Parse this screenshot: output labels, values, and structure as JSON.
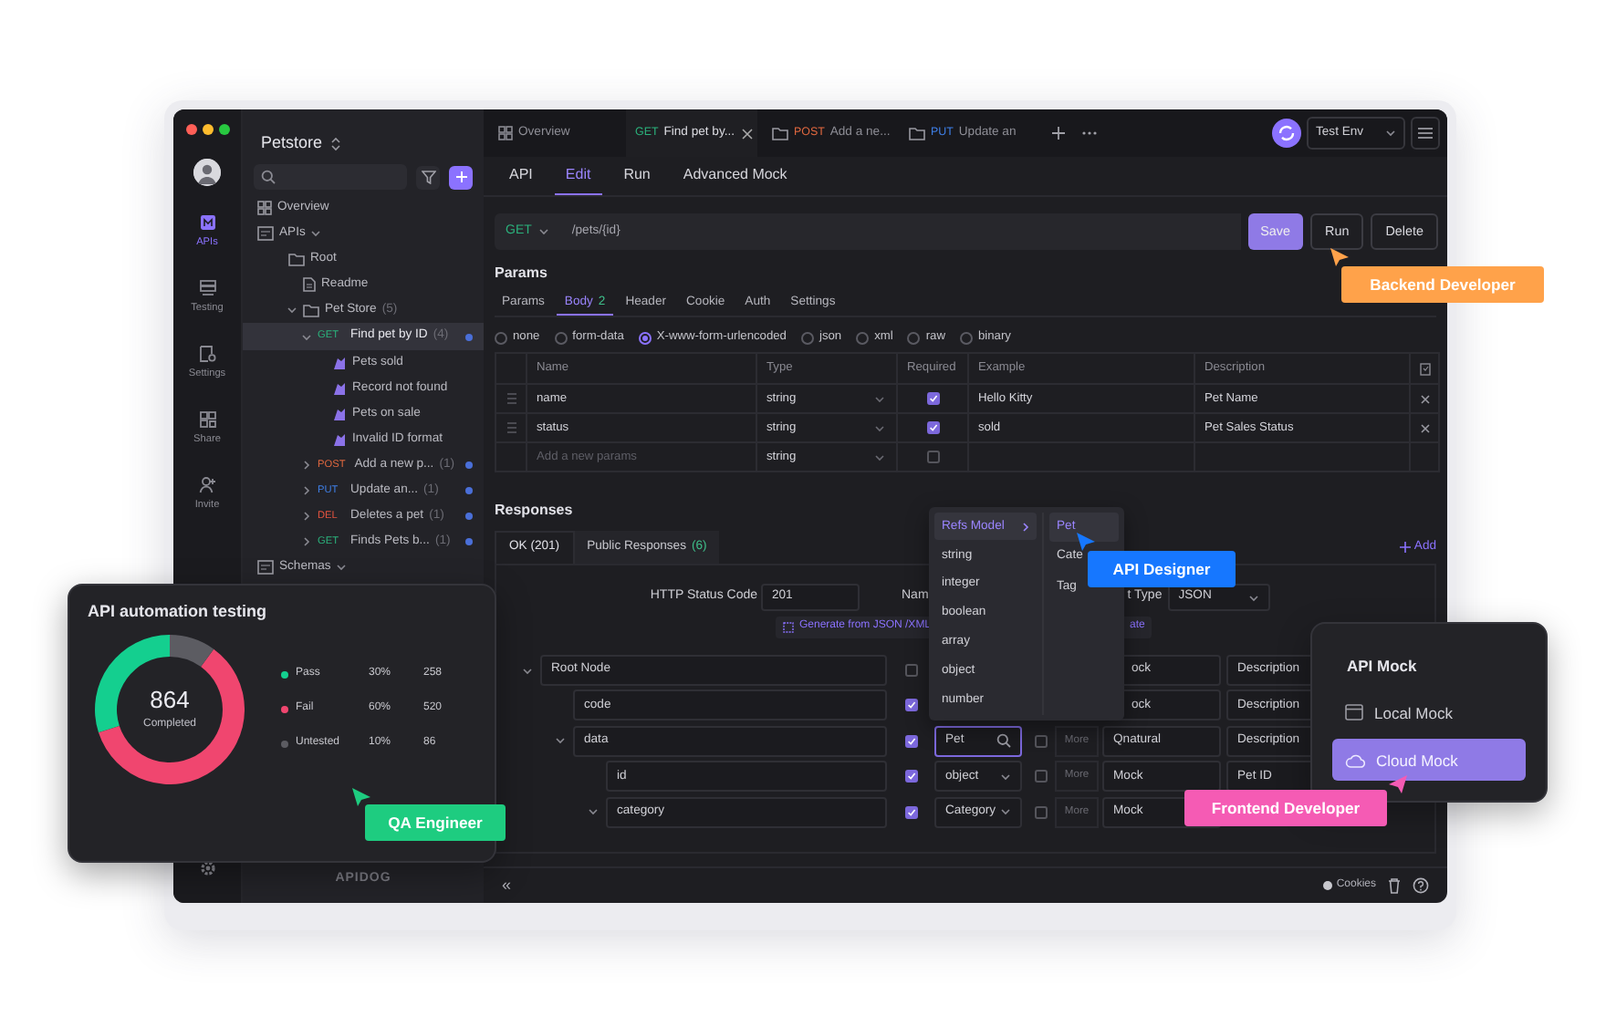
{
  "rail": {
    "items": [
      {
        "kind": "apis",
        "label": "APIs",
        "selected": true
      },
      {
        "kind": "testing",
        "label": "Testing",
        "selected": false
      },
      {
        "kind": "settings",
        "label": "Settings",
        "selected": false
      },
      {
        "kind": "share",
        "label": "Share",
        "selected": false
      },
      {
        "kind": "invite",
        "label": "Invite",
        "selected": false
      }
    ]
  },
  "sidebar": {
    "project": "Petstore",
    "logo": "APIDOG",
    "tree": [
      {
        "kind": "overview",
        "label": "Overview",
        "selected": false
      },
      {
        "kind": "group",
        "label": "APIs",
        "expanded": true,
        "selected": false,
        "children": [
          {
            "kind": "folder",
            "label": "Root",
            "selected": false,
            "children": [
              {
                "kind": "doc",
                "label": "Readme",
                "selected": false
              },
              {
                "kind": "folder",
                "label": "Pet Store",
                "count": "(5)",
                "expanded": true,
                "selected": false,
                "children": [
                  {
                    "kind": "api",
                    "method": "GET",
                    "color": "#2bb27c",
                    "label": "Find pet by ID",
                    "count": "(4)",
                    "expanded": true,
                    "selected": true,
                    "children": [
                      {
                        "kind": "case",
                        "label": "Pets sold",
                        "selected": false
                      },
                      {
                        "kind": "case",
                        "label": "Record not found",
                        "selected": false
                      },
                      {
                        "kind": "case",
                        "label": "Pets on sale",
                        "selected": false
                      },
                      {
                        "kind": "case",
                        "label": "Invalid ID format",
                        "selected": false
                      }
                    ]
                  },
                  {
                    "kind": "api",
                    "method": "POST",
                    "color": "#e0683f",
                    "label": "Add a new p...",
                    "count": "(1)",
                    "expanded": false,
                    "selected": false
                  },
                  {
                    "kind": "api",
                    "method": "PUT",
                    "color": "#3f7fe6",
                    "label": "Update an...",
                    "count": "(1)",
                    "expanded": false,
                    "selected": false
                  },
                  {
                    "kind": "api",
                    "method": "DEL",
                    "color": "#e2533f",
                    "label": "Deletes a pet",
                    "count": "(1)",
                    "expanded": false,
                    "selected": false
                  },
                  {
                    "kind": "api",
                    "method": "GET",
                    "color": "#2bb27c",
                    "label": "Finds Pets b...",
                    "count": "(1)",
                    "expanded": false,
                    "selected": false
                  }
                ]
              }
            ]
          }
        ]
      },
      {
        "kind": "group",
        "label": "Schemas",
        "expanded": true,
        "selected": false
      }
    ]
  },
  "tabs": [
    {
      "kind": "overview",
      "label": "Overview",
      "selected": false
    },
    {
      "kind": "api",
      "method": "GET",
      "color": "#2bb27c",
      "label": "Find pet by...",
      "selected": true
    },
    {
      "kind": "folder",
      "method": "POST",
      "color": "#e0683f",
      "label": "Add a ne...",
      "selected": false
    },
    {
      "kind": "folder",
      "method": "PUT",
      "color": "#3f7fe6",
      "label": "Update an",
      "selected": false
    }
  ],
  "environment": "Test Env",
  "editor_tabs": [
    {
      "label": "API",
      "selected": false
    },
    {
      "label": "Edit",
      "selected": true
    },
    {
      "label": "Run",
      "selected": false
    },
    {
      "label": "Advanced Mock",
      "selected": false
    }
  ],
  "request": {
    "method": "GET",
    "path": "/pets/{id}",
    "buttons": [
      {
        "label": "Save",
        "kind": "primary"
      },
      {
        "label": "Run",
        "kind": "outline"
      },
      {
        "label": "Delete",
        "kind": "outline"
      }
    ]
  },
  "params": {
    "title": "Params",
    "tabs": [
      {
        "label": "Params",
        "selected": false
      },
      {
        "label": "Body",
        "count": "2",
        "selected": true
      },
      {
        "label": "Header",
        "selected": false
      },
      {
        "label": "Cookie",
        "selected": false
      },
      {
        "label": "Auth",
        "selected": false
      },
      {
        "label": "Settings",
        "selected": false
      }
    ],
    "body_types": [
      {
        "label": "none",
        "selected": false
      },
      {
        "label": "form-data",
        "selected": false
      },
      {
        "label": "X-www-form-urlencoded",
        "selected": true
      },
      {
        "label": "json",
        "selected": false
      },
      {
        "label": "xml",
        "selected": false
      },
      {
        "label": "raw",
        "selected": false
      },
      {
        "label": "binary",
        "selected": false
      }
    ],
    "columns": [
      "Name",
      "Type",
      "Required",
      "Example",
      "Description"
    ],
    "rows": [
      {
        "name": "name",
        "type": "string",
        "required": true,
        "example": "Hello Kitty",
        "description": "Pet Name"
      },
      {
        "name": "status",
        "type": "string",
        "required": true,
        "example": "sold",
        "description": "Pet Sales Status"
      },
      {
        "placeholder": "Add a new params",
        "type": "string",
        "required": false
      }
    ]
  },
  "responses": {
    "title": "Responses",
    "tabs": [
      {
        "label": "OK (201)",
        "selected": true
      },
      {
        "label": "Public Responses",
        "count": "(6)",
        "selected": false
      }
    ],
    "add": "Add",
    "status_code_label": "HTTP Status Code",
    "status_code": "201",
    "name_label": "Nam",
    "content_type_label": "t Type",
    "content_type": "JSON",
    "generate": "Generate from JSON /XML",
    "generate_2": "ate",
    "tree": [
      {
        "name": "Root Node",
        "expanded": true,
        "required": false,
        "mock": {
          "placeholder": "ock"
        },
        "description": {
          "placeholder": "Description"
        },
        "children": [
          {
            "name": "code",
            "required": true,
            "mock": {
              "placeholder": "ock"
            },
            "description": {
              "placeholder": "Description"
            }
          },
          {
            "name": "data",
            "expanded": true,
            "required": true,
            "type": {
              "kind": "search",
              "value": "Pet"
            },
            "nullable": false,
            "more": "More",
            "mock": {
              "value": "Qnatural"
            },
            "description": {
              "placeholder": "Description"
            },
            "children": [
              {
                "name": "id",
                "required": true,
                "type": {
                  "kind": "select",
                  "value": "object"
                },
                "nullable": false,
                "more": "More",
                "mock": {
                  "placeholder": "Mock"
                },
                "description": {
                  "value": "Pet ID"
                }
              },
              {
                "name": "category",
                "expanded": true,
                "required": true,
                "type": {
                  "kind": "select",
                  "value": "Category"
                },
                "nullable": false,
                "more": "More",
                "mock": {
                  "placeholder": "Mock"
                }
              }
            ]
          }
        ]
      }
    ]
  },
  "refs_menu": {
    "items": [
      {
        "kind": "submenu",
        "label": "Refs Model",
        "selected": true
      },
      {
        "kind": "type",
        "label": "string",
        "selected": false
      },
      {
        "kind": "type",
        "label": "integer",
        "selected": false
      },
      {
        "kind": "type",
        "label": "boolean",
        "selected": false
      },
      {
        "kind": "type",
        "label": "array",
        "selected": false
      },
      {
        "kind": "type",
        "label": "object",
        "selected": false
      },
      {
        "kind": "type",
        "label": "number",
        "selected": false
      }
    ],
    "submenu": [
      {
        "label": "Pet",
        "selected": true
      },
      {
        "label": "Cate",
        "selected": false
      },
      {
        "label": "Tag",
        "selected": false
      }
    ]
  },
  "status_bar": {
    "collapse": "«",
    "cookies": "Cookies"
  },
  "testing_card": {
    "title": "API automation testing",
    "total": "864",
    "total_label": "Completed",
    "chart_data": {
      "type": "donut",
      "categories": [
        "Pass",
        "Fail",
        "Untested"
      ],
      "values": [
        30,
        60,
        10
      ]
    },
    "legend": [
      {
        "percent": "30%",
        "count": "258",
        "color": "#14cf8f"
      },
      {
        "percent": "60%",
        "count": "520",
        "color": "#f0466f"
      },
      {
        "percent": "10%",
        "count": "86",
        "color": "#5c5c62"
      }
    ]
  },
  "mock_card": {
    "title": "API Mock",
    "items": [
      {
        "kind": "local",
        "label": "Local Mock",
        "selected": false
      },
      {
        "kind": "cloud",
        "label": "Cloud Mock",
        "selected": true
      }
    ]
  },
  "roles": [
    {
      "label": "Backend Developer",
      "color": "#ffa24a"
    },
    {
      "label": "API Designer",
      "color": "#1677ff"
    },
    {
      "label": "QA Engineer",
      "color": "#1ecc80"
    },
    {
      "label": "Frontend Developer",
      "color": "#f55bb4"
    }
  ]
}
